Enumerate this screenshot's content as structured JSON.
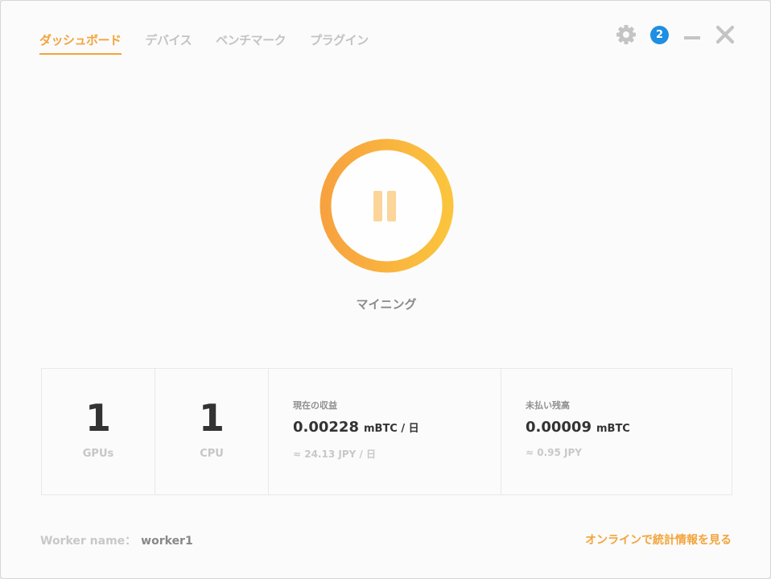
{
  "tabs": [
    {
      "label": "ダッシュボード",
      "active": true
    },
    {
      "label": "デバイス",
      "active": false
    },
    {
      "label": "ベンチマーク",
      "active": false
    },
    {
      "label": "プラグイン",
      "active": false
    }
  ],
  "controls": {
    "settings_icon": "gear-icon",
    "notification_count": "2",
    "minimize_icon": "minimize-icon",
    "close_icon": "close-icon"
  },
  "mining": {
    "status_label": "マイニング",
    "button_icon": "pause-icon",
    "ring_color_start": "#f7a23f",
    "ring_color_end": "#fbc43d"
  },
  "stats": {
    "gpus": {
      "count": "1",
      "label": "GPUs"
    },
    "cpu": {
      "count": "1",
      "label": "CPU"
    },
    "current_earnings": {
      "title": "現在の収益",
      "value": "0.00228",
      "unit": "mBTC / 日",
      "approx": "≈ 24.13 JPY / 日"
    },
    "unpaid_balance": {
      "title": "未払い残高",
      "value": "0.00009",
      "unit": "mBTC",
      "approx": "≈ 0.95 JPY"
    }
  },
  "footer": {
    "worker_label": "Worker name：",
    "worker_name": "worker1",
    "online_stats_link": "オンラインで統計情報を見る"
  },
  "colors": {
    "accent": "#f3a43b",
    "notification": "#1e8fe1"
  }
}
